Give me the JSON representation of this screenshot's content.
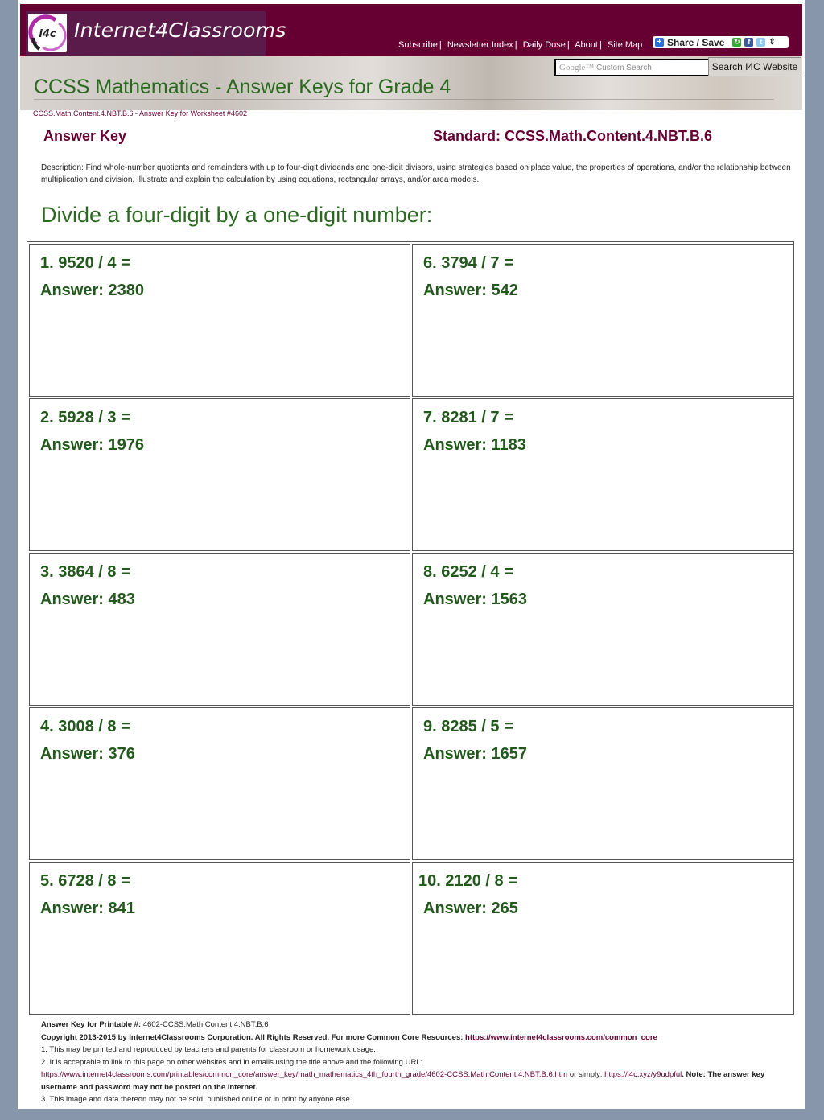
{
  "header": {
    "logo_badge": "i4c",
    "logo_text": "Internet4Classrooms",
    "nav_links": [
      "Subscribe",
      "Newsletter Index",
      "Daily Dose",
      "About",
      "Site Map"
    ],
    "share_label": "Share / Save"
  },
  "search": {
    "placeholder_brand": "Google™",
    "placeholder": "Custom Search",
    "button_label": "Search I4C Website"
  },
  "banner": {
    "title": "CCSS Mathematics - Answer Keys for Grade 4"
  },
  "breadcrumb": "CCSS.Math.Content.4.NBT.B.6 - Answer Key for Worksheet #4602",
  "answer_key_label": "Answer Key",
  "standard_label": "Standard: CCSS.Math.Content.4.NBT.B.6",
  "description": "Description: Find whole-number quotients and remainders with up to four-digit dividends and one-digit divisors, using strategies based on place value, the properties of operations, and/or the relationship between multiplication and division. Illustrate and explain the calculation by using equations, rectangular arrays, and/or area models.",
  "section_title": "Divide a four-digit by a one-digit number:",
  "problems": [
    {
      "question": "1. 9520 / 4 =",
      "answer": "Answer: 2380"
    },
    {
      "question": "6. 3794 / 7 =",
      "answer": "Answer: 542"
    },
    {
      "question": "2. 5928 / 3 =",
      "answer": "Answer: 1976"
    },
    {
      "question": "7. 8281 / 7 =",
      "answer": "Answer: 1183"
    },
    {
      "question": "3. 3864 / 8 =",
      "answer": "Answer: 483"
    },
    {
      "question": "8. 6252 / 4 =",
      "answer": "Answer: 1563"
    },
    {
      "question": "4. 3008 / 8 =",
      "answer": "Answer: 376"
    },
    {
      "question": "9. 8285 / 5 =",
      "answer": "Answer: 1657"
    },
    {
      "question": "5. 6728 / 8 =",
      "answer": "Answer: 841"
    },
    {
      "question": "10. 2120 / 8 =",
      "answer": "Answer: 265"
    }
  ],
  "footer": {
    "printable_label": "Answer Key for Printable #:",
    "printable_id": "4602-CCSS.Math.Content.4.NBT.B.6",
    "copyright": "Copyright 2013-2015 by Internet4Classrooms Corporation. All Rights Reserved. For more Common Core Resources:",
    "common_core_url": "https://www.internet4classrooms.com/common_core",
    "note1": "1. This may be printed and reproduced by teachers and parents for classroom or homework usage.",
    "note2": "2. It is acceptable to link to this page on other websites and in emails using the title above and the following URL:",
    "page_url": "https://www.internet4classrooms.com/printables/common_core/answer_key/math_mathematics_4th_fourth_grade/4602-CCSS.Math.Content.4.NBT.B.6.htm",
    "or_simply": "or simply:",
    "short_url": "https://i4c.xyz/y9udpful",
    "note_label": ". Note: The answer key username and password may not be posted on the internet.",
    "note3": "3. This image and data thereon may not be sold, published online or in print by anyone else."
  },
  "colors": {
    "brand_maroon": "#660033",
    "heading_green": "#2a6a1f",
    "answer_green": "#22581c",
    "page_background": "#8796ab"
  }
}
